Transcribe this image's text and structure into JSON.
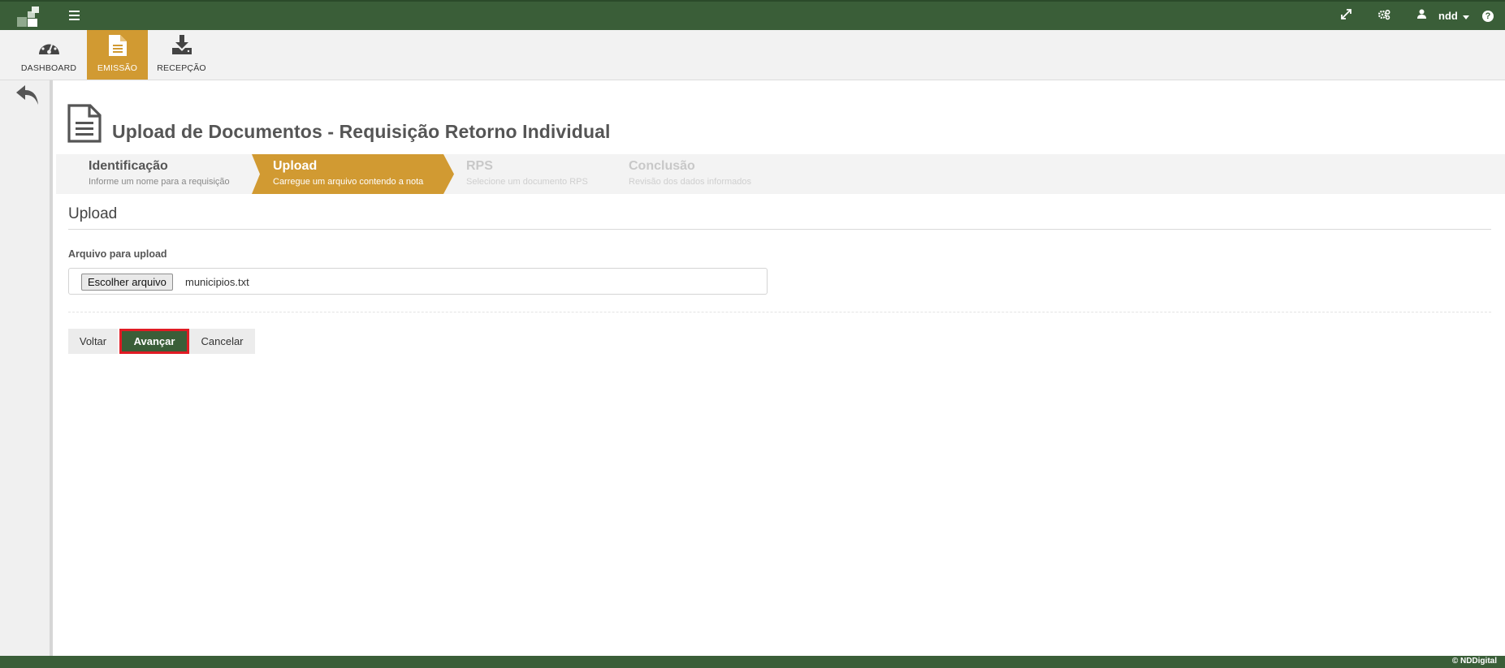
{
  "topbar": {
    "user_name": "ndd",
    "help_label": "?"
  },
  "modules": [
    {
      "label": "DASHBOARD",
      "icon": "dashboard-gauge-icon",
      "active": false
    },
    {
      "label": "EMISSÃO",
      "icon": "document-icon",
      "active": true
    },
    {
      "label": "RECEPÇÃO",
      "icon": "download-icon",
      "active": false
    }
  ],
  "page": {
    "title": "Upload de Documentos - Requisição Retorno Individual"
  },
  "wizard": {
    "steps": [
      {
        "title": "Identificação",
        "subtitle": "Informe um nome para a requisição",
        "state": "done"
      },
      {
        "title": "Upload",
        "subtitle": "Carregue um arquivo contendo a nota",
        "state": "current"
      },
      {
        "title": "RPS",
        "subtitle": "Selecione um documento RPS",
        "state": "pending"
      },
      {
        "title": "Conclusão",
        "subtitle": "Revisão dos dados informados",
        "state": "pending"
      }
    ]
  },
  "form": {
    "section_title": "Upload",
    "file_label": "Arquivo para upload",
    "file_button": "Escolher arquivo",
    "file_name": "municipios.txt"
  },
  "actions": {
    "back": "Voltar",
    "next": "Avançar",
    "cancel": "Cancelar"
  },
  "footer": {
    "copyright": "© NDDigital"
  },
  "colors": {
    "brand_green": "#3a5e38",
    "accent_gold": "#d19a32",
    "highlight_red": "#e01b24"
  }
}
